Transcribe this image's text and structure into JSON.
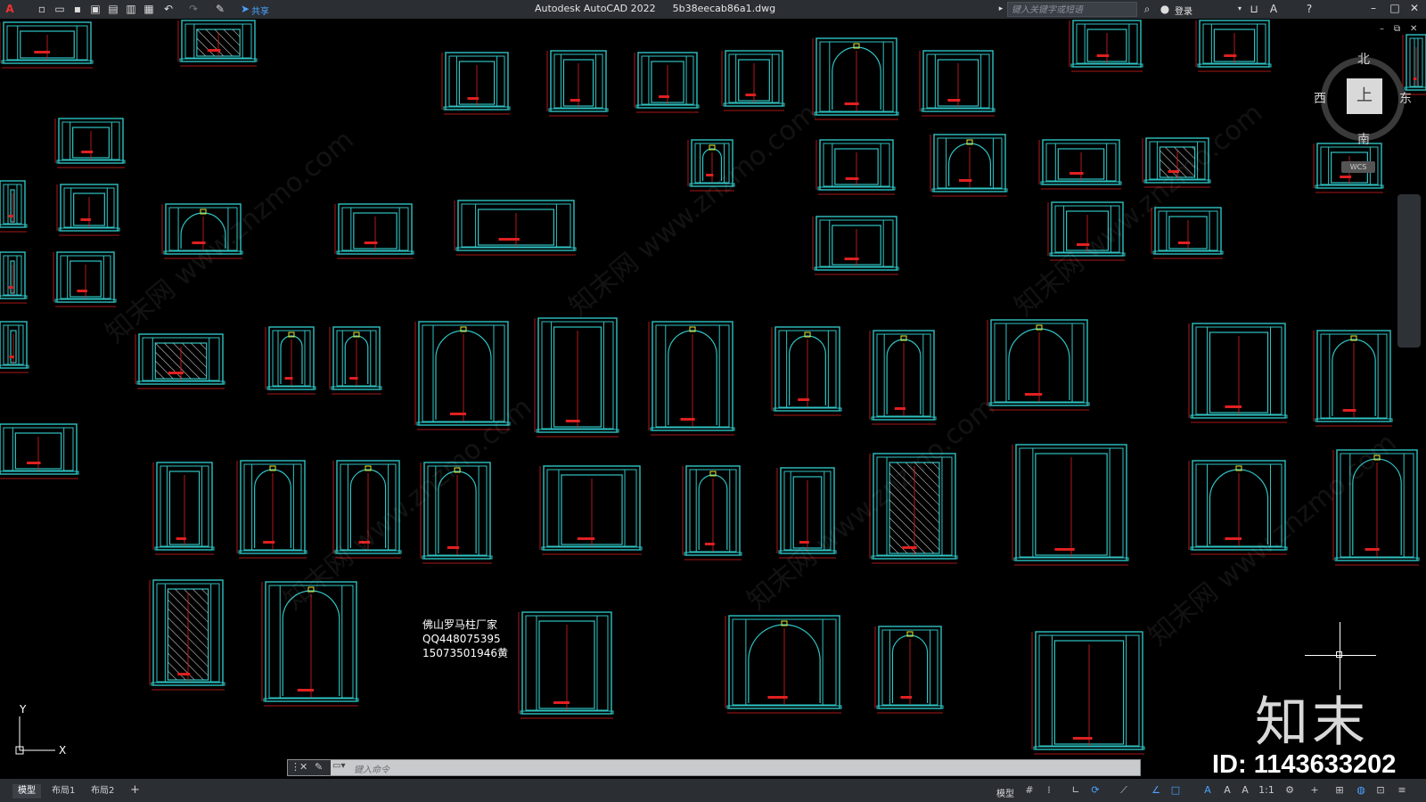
{
  "titlebar": {
    "app_name": "Autodesk AutoCAD 2022",
    "file_name": "5b38eecab86a1.dwg",
    "share_label": "共享",
    "search_placeholder": "键入关键字或短语",
    "login_label": "登录"
  },
  "viewcube": {
    "north": "北",
    "south": "南",
    "east": "东",
    "west": "西",
    "top_face": "上",
    "wcs_label": "WCS"
  },
  "drawing_note": {
    "line1": "佛山罗马柱厂家",
    "line2": "QQ448075395",
    "line3": "15073501946黄"
  },
  "ucs": {
    "x_label": "X",
    "y_label": "Y"
  },
  "watermark": {
    "brand": "知末",
    "id_text": "ID: 1143633202",
    "pattern_text": "知末网 www.znzmo.com"
  },
  "command_line": {
    "placeholder": "键入命令"
  },
  "layout_tabs": [
    {
      "label": "模型",
      "active": true
    },
    {
      "label": "布局1",
      "active": false
    },
    {
      "label": "布局2",
      "active": false
    }
  ],
  "statusbar": {
    "model_label": "模型",
    "scale_label": "1:1"
  },
  "colors": {
    "drawing_cyan": "#2fc3c3",
    "dimension_red": "#e02020",
    "accent_yellow": "#e8e830",
    "background": "#000000"
  }
}
